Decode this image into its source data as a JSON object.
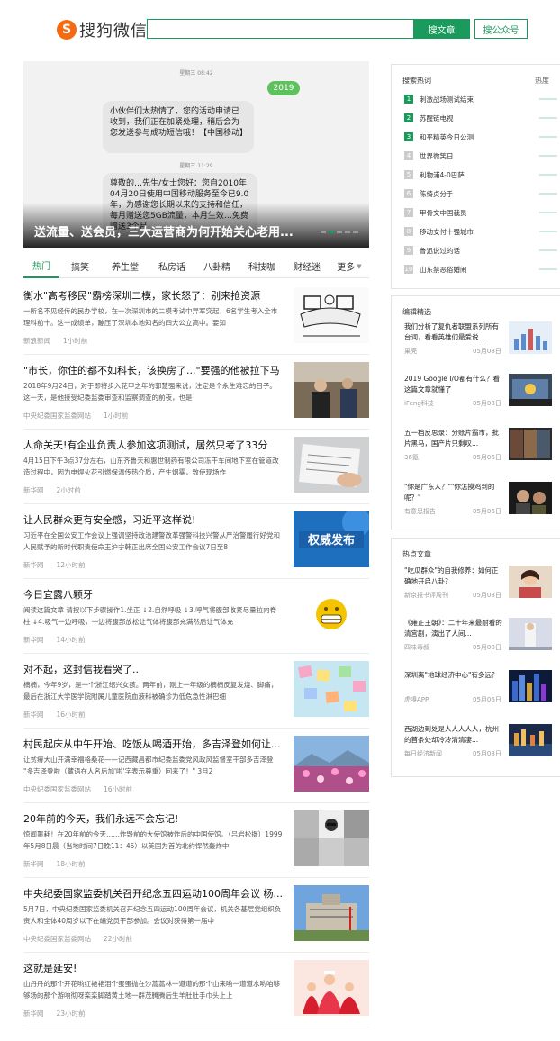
{
  "header": {
    "logo_mark": "S",
    "logo_text": "搜狗微信",
    "search_value": "",
    "btn_article": "搜文章",
    "btn_account": "搜公众号"
  },
  "banner": {
    "time1": "星期三 08:42",
    "green_msg": "2019",
    "bubble1": "小伙伴们太热情了，您的活动申请已收到，我们正在加紧处理，稍后会为您发送参与成功短信哦！【中国移动】",
    "time2": "星期三 11:29",
    "bubble2": "尊敬的…先生/女士您好：您自2010年04月20日使用中国移动服务至今已9.0年，为感谢您长期以来的支持和信任，每月赠送您5GB流量，本月生效…免费赠送3个月",
    "caption": "送流量、送会员，三大运营商为何开始关心老用..."
  },
  "tabs": [
    "热门",
    "搞笑",
    "养生堂",
    "私房话",
    "八卦精",
    "科技咖",
    "财经迷",
    "更多"
  ],
  "feed": [
    {
      "title": "衡水\"高考移民\"霸榜深圳二模，家长怒了：别来抢资源",
      "desc": "一所名不见经传的民办学校，在一次深圳市的二模考试中异军突起，6名学生考入全市理科前十。这一成绩单，蹦压了深圳本地知名的四大公立高中。要知",
      "source": "新浪新闻",
      "time": "1小时前"
    },
    {
      "title": "\"市长，你住的都不如科长，该换房了...\"要强的他被拉下马",
      "desc": "2018年9月24日，对于即将步入花甲之年的郭慧强来说，注定是个永生难忘的日子。这一天，是他接受纪委监委审查和监察调查的前夜，也是",
      "source": "中央纪委国家监委网站",
      "time": "1小时前"
    },
    {
      "title": "人命关天!有企业负责人参加这项测试，居然只考了33分",
      "desc": "4月15日下午3点37分左右，山东齐鲁天和惠世制药有限公司冻干车间地下室在管道改造过程中，因为电焊火花引燃保温传热介质，产生烟雾，致使现场作",
      "source": "新华网",
      "time": "2小时前"
    },
    {
      "title": "让人民群众更有安全感，习近平这样说!",
      "desc": "习近平在全国公安工作会议上强调坚持政治建警改革强警科技兴警从严治警履行好党和人民赋予的新时代职责使命王沪宁韩正出席全国公安工作会议7日至8",
      "source": "新华网",
      "time": "12小时前"
    },
    {
      "title": "今日宜露八颗牙",
      "desc": "阅读这篇文章 请按以下步骤操作1.坐正 ↓2.自然呼吸 ↓3.呼气将腹部收紧尽量拉向脊柱 ↓4.吸气一边呼吸，一边将腹部放松让气体将腹部充满然后让气体充",
      "source": "新华网",
      "time": "14小时前"
    },
    {
      "title": "对不起，这封信我看哭了..",
      "desc": "楠楠，今年9岁，是一个浙江绍兴女孩。两年前，刚上一年级的楠楠反复发烧、脚痛，最后在浙江大学医学院附属儿童医院血液科被确诊为低危急性淋巴细",
      "source": "新华网",
      "time": "16小时前"
    },
    {
      "title": "村民起床从中午开始、吃饭从喝酒开始，多吉泽登如何让...",
      "desc": "让贫瘠大山开满幸福格桑花——记西藏昌都市纪委监委党风政风监督室干部多吉泽登 \"多吉泽登啦（藏语在人名后加'啦'字表示尊重）回来了！\" 3月2",
      "source": "中央纪委国家监委网站",
      "time": "16小时前"
    },
    {
      "title": "20年前的今天，我们永远不会忘记!",
      "desc": "惊闻噩耗！在20年前的今天……炸毁前的大使馆被炸后的中国使馆。（吕岩松摄）1999年5月8日晨（当地时间7日晚11：45）以美国为首的北约悍然轰炸中",
      "source": "新华网",
      "time": "18小时前"
    },
    {
      "title": "中央纪委国家监委机关召开纪念五四运动100周年会议 杨...",
      "desc": "5月7日，中央纪委国家监委机关召开纪念五四运动100周年会议，机关各基层党组织负责人和全体40周岁以下在编党员干部参加。会议对获得第一届中",
      "source": "中央纪委国家监委网站",
      "time": "22小时前"
    },
    {
      "title": "这就是延安!",
      "desc": "山丹丹的那个开花哟红艳艳泪个蛋蛋抛在沙蒿蒿林一道道的那个山来哟一道道水哟咱够够场的那个游响彻呀栾栾脚踏黄土地一群茂腾腾后生羊肚肚手巾头上上",
      "source": "新华网",
      "time": "23小时前"
    }
  ],
  "hot": {
    "title": "搜索热词",
    "sub": "热度",
    "items": [
      "刺激战场测试结束",
      "苏醒链电视",
      "和平精英今日公测",
      "世界微笑日",
      "利物浦4-0巴萨",
      "陈绮贞分手",
      "甲骨文中国裁员",
      "移动支付十强城市",
      "鲁迅说过的话",
      "山东禁恶俗婚闹"
    ]
  },
  "editor": {
    "title": "编辑精选",
    "items": [
      {
        "text": "我们分析了复仇者联盟系列所有台词，看看英雄们最爱说...",
        "source": "果壳",
        "date": "05月08日"
      },
      {
        "text": "2019 Google I/O都有什么？看这篇文章就懂了",
        "source": "iFeng科技",
        "date": "05月08日"
      },
      {
        "text": "五一档反思录：分账片霸市，批片黑马，国产片只剩叹...",
        "source": "36氪",
        "date": "05月06日"
      },
      {
        "text": "\"你是广东人？\"\"你怎摸鸡到的呢？\"",
        "source": "有意思报告",
        "date": "05月06日"
      }
    ]
  },
  "hotarticles": {
    "title": "热点文章",
    "items": [
      {
        "text": "\"吃瓜群众\"的自我修养：如何正确地开启八卦?",
        "source": "新京报书评周刊",
        "date": "05月08日"
      },
      {
        "text": "《雍正王朝》：二十年来最耐看的清宫剧，演出了人间...",
        "source": "四味毒叔",
        "date": "05月08日"
      },
      {
        "text": "深圳离\"地球经济中心\"有多远？",
        "source": "虎嗅APP",
        "date": "05月06日"
      },
      {
        "text": "西湖边到处是人人人人人，杭州的首条处却冷冷清清凄...",
        "source": "每日经济新闻",
        "date": "05月08日"
      }
    ]
  },
  "colors": {
    "accent": "#1a9a5c",
    "logo": "#f56b12"
  }
}
